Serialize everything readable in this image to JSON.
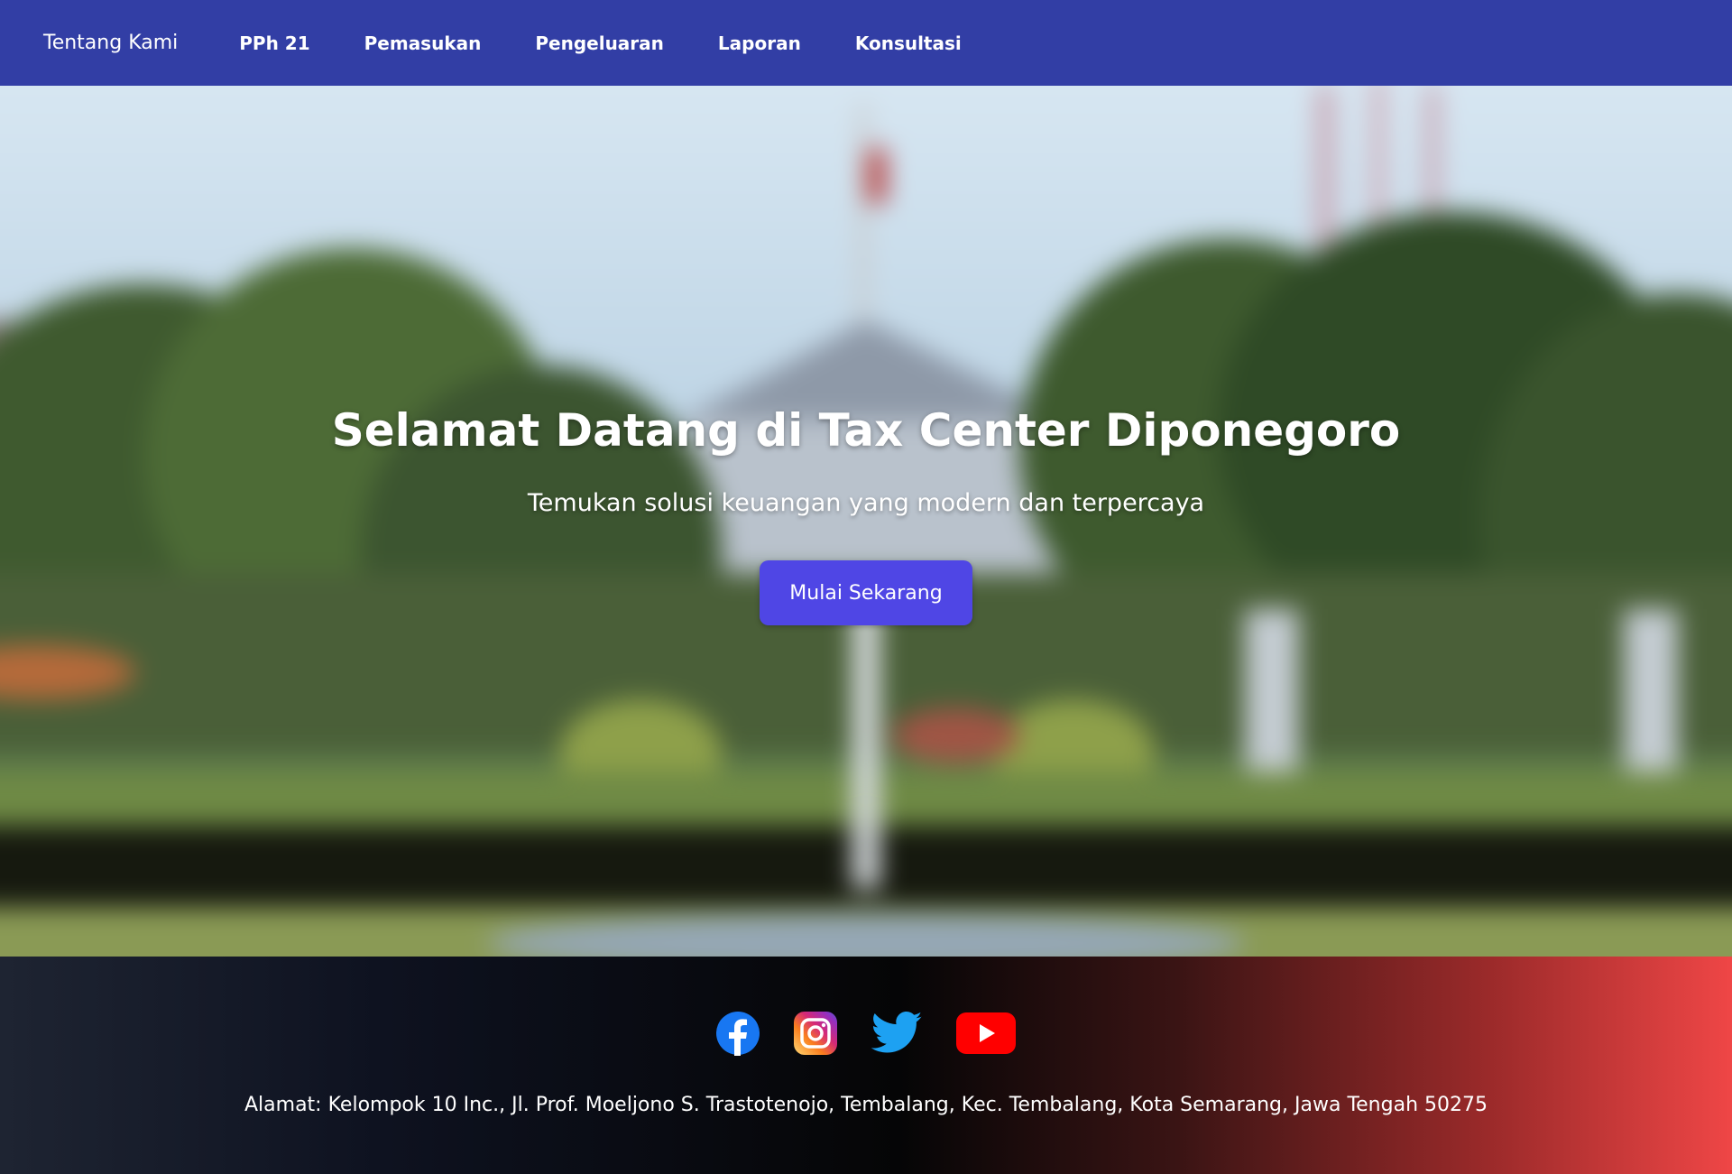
{
  "nav": {
    "brand": "Tentang Kami",
    "links": [
      {
        "label": "PPh 21"
      },
      {
        "label": "Pemasukan"
      },
      {
        "label": "Pengeluaran"
      },
      {
        "label": "Laporan"
      },
      {
        "label": "Konsultasi"
      }
    ],
    "background": "#323ea5"
  },
  "hero": {
    "title": "Selamat Datang di Tax Center Diponegoro",
    "subtitle": "Temukan solusi keuangan yang modern dan terpercaya",
    "cta_label": "Mulai Sekarang",
    "cta_color": "#4f46e5"
  },
  "footer": {
    "socials": [
      {
        "name": "facebook-icon",
        "color": "#1877f2"
      },
      {
        "name": "instagram-icon",
        "color": "#e1306c"
      },
      {
        "name": "twitter-icon",
        "color": "#1da1f2"
      },
      {
        "name": "youtube-icon",
        "color": "#ff0000"
      }
    ],
    "address": "Alamat: Kelompok 10 Inc., Jl. Prof. Moeljono S. Trastotenojo, Tembalang, Kec. Tembalang, Kota Semarang, Jawa Tengah 50275"
  }
}
